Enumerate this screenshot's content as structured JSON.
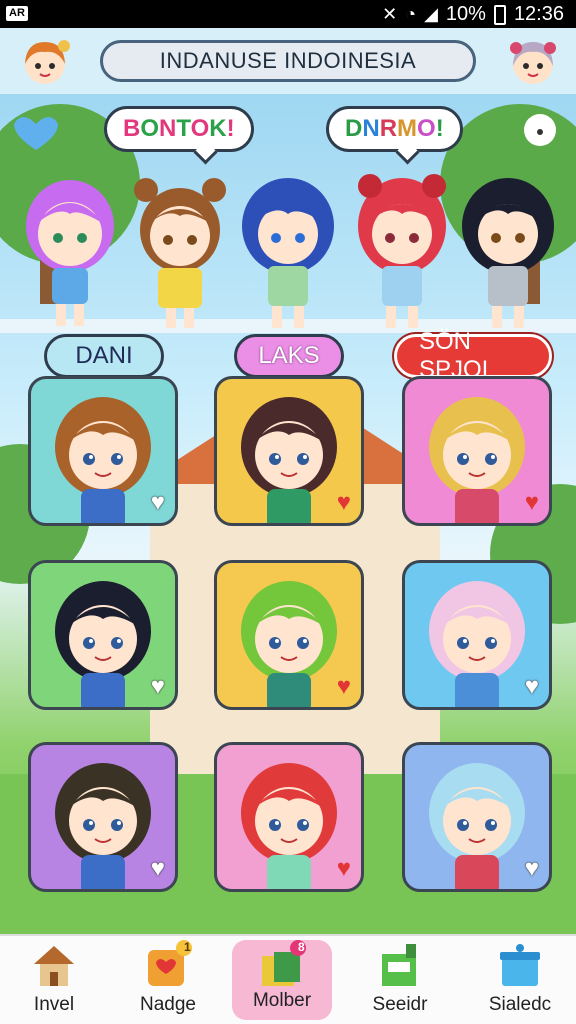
{
  "status_bar": {
    "badge": "AR",
    "battery": "10%",
    "time": "12:36"
  },
  "header": {
    "title": "INDANUSE INDOINESIA"
  },
  "scene": {
    "bubble_left": "BONTOK!",
    "bubble_right": "DNRMO!",
    "tags": [
      "DANI",
      "LAKS",
      "SÖN SPJQI"
    ]
  },
  "cards": [
    {
      "bg": "#7fd7d6",
      "heart": "empty"
    },
    {
      "bg": "#f4c84b",
      "heart": "full"
    },
    {
      "bg": "#f08ad4",
      "heart": "full"
    },
    {
      "bg": "#7fd67a",
      "heart": "empty"
    },
    {
      "bg": "#f5c94f",
      "heart": "full"
    },
    {
      "bg": "#6fc8ef",
      "heart": "empty"
    },
    {
      "bg": "#b784e3",
      "heart": "empty"
    },
    {
      "bg": "#f29fd1",
      "heart": "full"
    },
    {
      "bg": "#8fb6ee",
      "heart": "empty"
    }
  ],
  "nav": [
    {
      "label": "Invel",
      "icon": "house-icon"
    },
    {
      "label": "Nadge",
      "icon": "heart-badge-icon",
      "badge": "1"
    },
    {
      "label": "Molber",
      "icon": "gift-box-icon",
      "badge": "8",
      "active": true
    },
    {
      "label": "Seeidr",
      "icon": "shopping-bag-icon"
    },
    {
      "label": "Sialedc",
      "icon": "storage-box-icon"
    }
  ],
  "colors": {
    "accent": "#47637d",
    "nav_active": "#f7b8d4",
    "heart": "#e23636"
  }
}
